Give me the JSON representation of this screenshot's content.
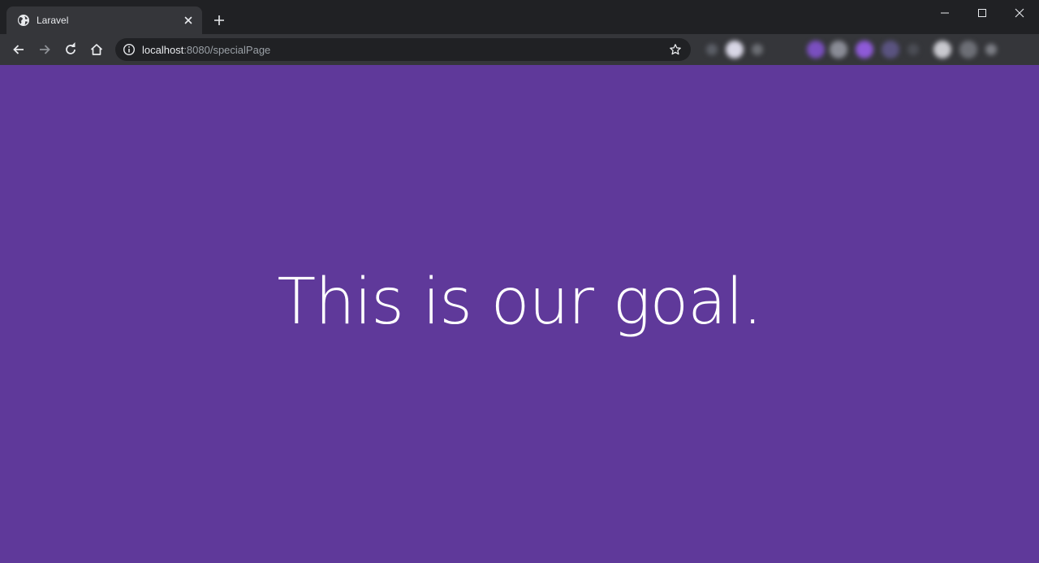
{
  "browser": {
    "tab": {
      "title": "Laravel"
    },
    "address_bar": {
      "host": "localhost",
      "rest": ":8080/specialPage"
    }
  },
  "page": {
    "background_color": "#5f399a",
    "headline": "This is our goal."
  },
  "icons": {
    "tab_favicon": "globe-icon",
    "tab_close": "close-icon",
    "new_tab": "plus-icon",
    "back": "arrow-left-icon",
    "forward": "arrow-right-icon",
    "reload": "reload-icon",
    "home": "home-icon",
    "site_info": "info-icon",
    "bookmark": "star-icon",
    "minimize": "minimize-icon",
    "maximize": "maximize-icon",
    "window_close": "close-icon"
  }
}
